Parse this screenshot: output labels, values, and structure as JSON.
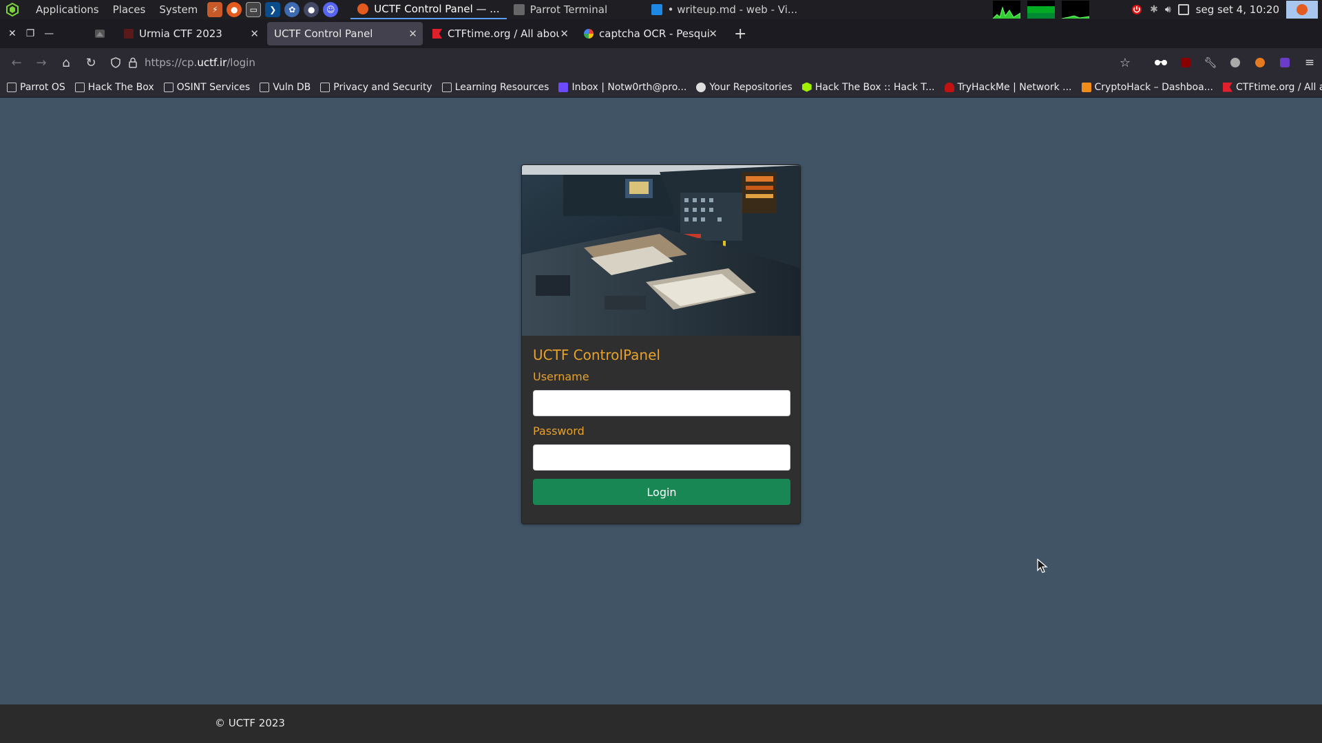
{
  "system_panel": {
    "menu": [
      "Applications",
      "Places",
      "System"
    ],
    "tasks": [
      {
        "label": "UCTF Control Panel — ..."
      },
      {
        "label": "Parrot Terminal"
      },
      {
        "label": "• writeup.md - web - Vi..."
      }
    ],
    "clock": "seg set  4, 10:20"
  },
  "browser": {
    "tabs": [
      {
        "label": "Urmia CTF 2023"
      },
      {
        "label": "UCTF Control Panel"
      },
      {
        "label": "CTFtime.org / All about C"
      },
      {
        "label": "captcha OCR - Pesquisa G"
      }
    ],
    "url_prefix": "https://cp.",
    "url_domain": "uctf.ir",
    "url_path": "/login",
    "bookmarks": [
      {
        "label": "Parrot OS",
        "icon": "folder-icon"
      },
      {
        "label": "Hack The Box",
        "icon": "folder-icon"
      },
      {
        "label": "OSINT Services",
        "icon": "folder-icon"
      },
      {
        "label": "Vuln DB",
        "icon": "folder-icon"
      },
      {
        "label": "Privacy and Security",
        "icon": "folder-icon"
      },
      {
        "label": "Learning Resources",
        "icon": "folder-icon"
      },
      {
        "label": "Inbox | Notw0rth@pro...",
        "icon": "mail-icon"
      },
      {
        "label": "Your Repositories",
        "icon": "github-icon"
      },
      {
        "label": "Hack The Box :: Hack T...",
        "icon": "htb-icon"
      },
      {
        "label": "TryHackMe | Network ...",
        "icon": "thm-icon"
      },
      {
        "label": "CryptoHack – Dashboa...",
        "icon": "cryptohack-icon"
      },
      {
        "label": "CTFtime.org / All abou...",
        "icon": "ctftime-icon"
      }
    ]
  },
  "login": {
    "title": "UCTF ControlPanel",
    "username_label": "Username",
    "password_label": "Password",
    "button": "Login"
  },
  "footer": {
    "text": "© UCTF 2023"
  },
  "colors": {
    "page_bg": "#415466",
    "accent": "#e7a12c",
    "button": "#198754"
  }
}
